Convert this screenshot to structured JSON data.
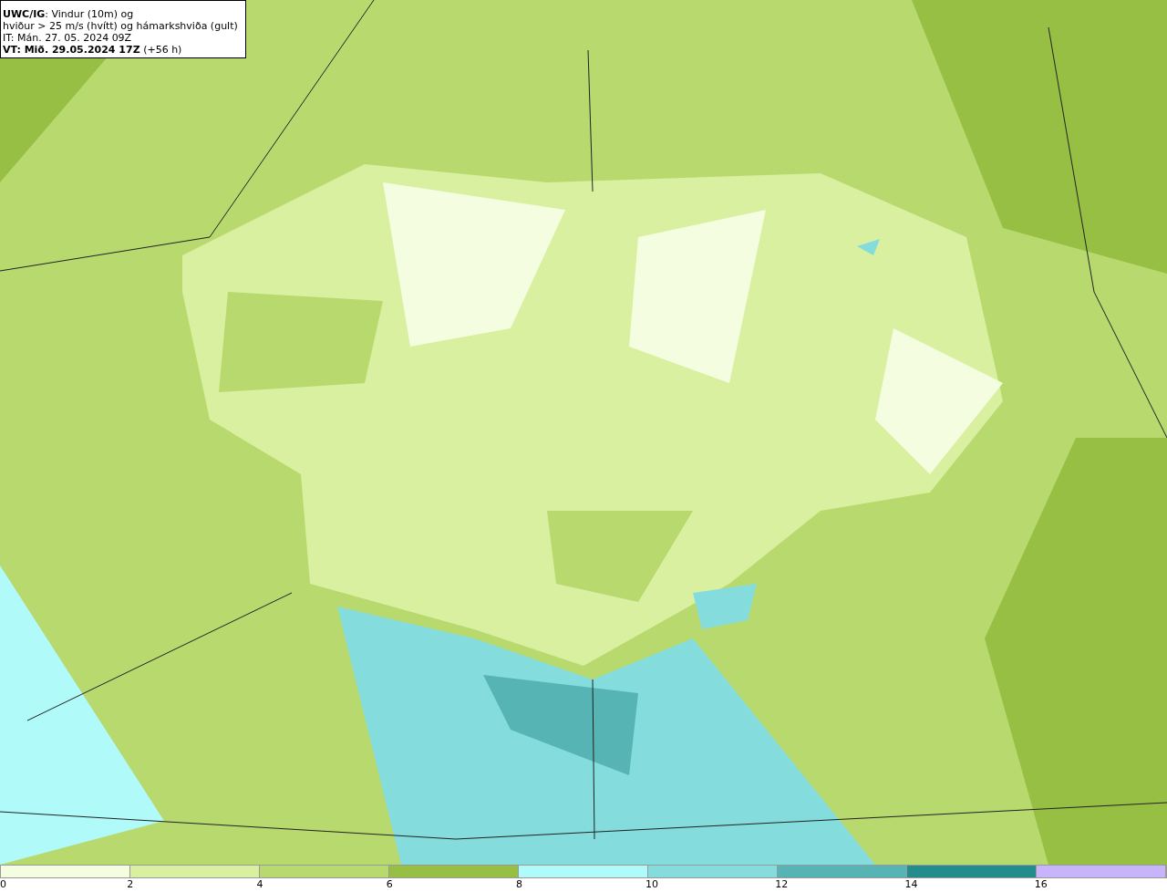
{
  "title_box": {
    "lines": [
      "**UWC/IG**: Vindur (10m) og",
      "hviður > 25 m/s (hvítt) og hámarkshviða (gult)",
      "IT: Mán. 27. 05. 2024 09Z",
      "**VT: Mið. 29.05.2024 17Z** (+56 h)"
    ]
  },
  "legend": {
    "bins": [
      {
        "color": "#f5fde0"
      },
      {
        "color": "#d9f0a0"
      },
      {
        "color": "#b8d96e"
      },
      {
        "color": "#96bf44"
      },
      {
        "color": "#b0fafa"
      },
      {
        "color": "#84dcdc"
      },
      {
        "color": "#56b4b4"
      },
      {
        "color": "#238c8c"
      },
      {
        "color": "#c8b4fa"
      }
    ],
    "ticks": [
      "0",
      "2",
      "4",
      "6",
      "8",
      "10",
      "12",
      "14",
      "16"
    ]
  }
}
